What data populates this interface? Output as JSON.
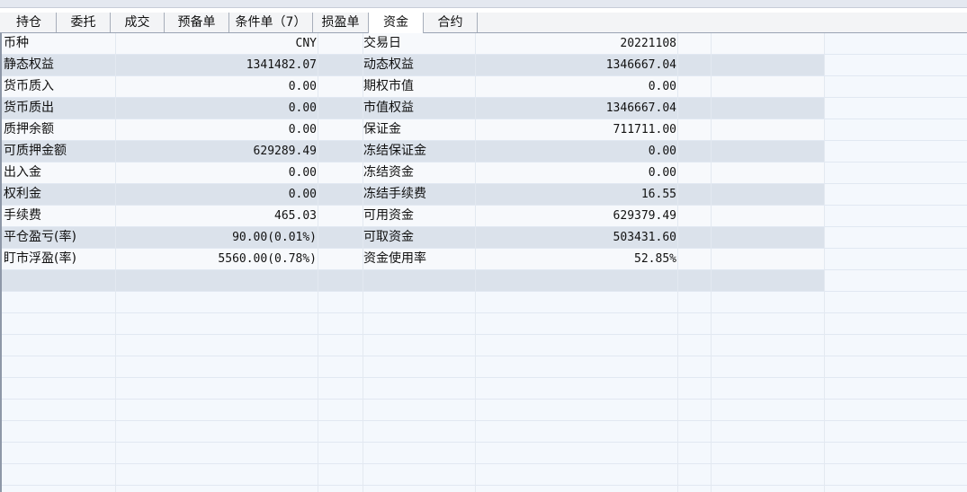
{
  "tabs": [
    {
      "label": "持仓",
      "active": false
    },
    {
      "label": "委托",
      "active": false
    },
    {
      "label": "成交",
      "active": false
    },
    {
      "label": "预备单",
      "active": false
    },
    {
      "label": "条件单（7）",
      "active": false
    },
    {
      "label": "损盈单",
      "active": false
    },
    {
      "label": "资金",
      "active": true
    },
    {
      "label": "合约",
      "active": false
    }
  ],
  "rows": [
    {
      "label1": "币种",
      "value1": "CNY",
      "label2": "交易日",
      "value2": "20221108"
    },
    {
      "label1": "静态权益",
      "value1": "1341482.07",
      "label2": "动态权益",
      "value2": "1346667.04"
    },
    {
      "label1": "货币质入",
      "value1": "0.00",
      "label2": "期权市值",
      "value2": "0.00"
    },
    {
      "label1": "货币质出",
      "value1": "0.00",
      "label2": "市值权益",
      "value2": "1346667.04"
    },
    {
      "label1": "质押余额",
      "value1": "0.00",
      "label2": "保证金",
      "value2": "711711.00"
    },
    {
      "label1": "可质押金额",
      "value1": "629289.49",
      "label2": "冻结保证金",
      "value2": "0.00"
    },
    {
      "label1": "出入金",
      "value1": "0.00",
      "label2": "冻结资金",
      "value2": "0.00"
    },
    {
      "label1": "权利金",
      "value1": "0.00",
      "label2": "冻结手续费",
      "value2": "16.55"
    },
    {
      "label1": "手续费",
      "value1": "465.03",
      "label2": "可用资金",
      "value2": "629379.49"
    },
    {
      "label1": "平仓盈亏(率)",
      "value1": "90.00(0.01%)",
      "label2": "可取资金",
      "value2": "503431.60"
    },
    {
      "label1": "盯市浮盈(率)",
      "value1": "5560.00(0.78%)",
      "label2": "资金使用率",
      "value2": "52.85%"
    }
  ]
}
